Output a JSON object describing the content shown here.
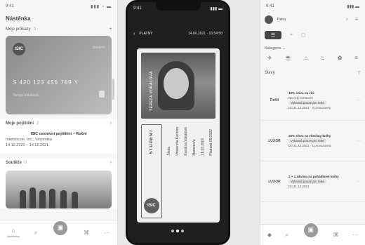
{
  "left": {
    "status_time": "9:41",
    "status_icons": "▮▮▮ ◔ ▬",
    "title": "Nástěnka",
    "cards_section": {
      "label": "Moje průkazy",
      "count": "0",
      "action": "+"
    },
    "card": {
      "logo": "ISIC",
      "tag": "Student",
      "number": "S 420 123 456 789 Y",
      "holder": "Tereza Vokálová"
    },
    "insurance_section": {
      "label": "Moje pojištění",
      "count": "2"
    },
    "insurance": {
      "title": "ISIC cestovní pojištění – Roční",
      "line1": "Intersoccer, Inc., Vincentka",
      "line2": "14.12.2020 – 14.12.2021"
    },
    "contests_section": {
      "label": "Soutěže",
      "count": "0"
    },
    "tabs": [
      {
        "icon": "⌂",
        "label": "Nástěnka"
      },
      {
        "icon": "⌕",
        "label": ""
      },
      {
        "icon": "▣",
        "label": ""
      },
      {
        "icon": "⌘",
        "label": ""
      },
      {
        "icon": "···",
        "label": ""
      }
    ]
  },
  "phone": {
    "status_time": "9:41",
    "status_icons": "▮▮▮ ▬",
    "back_icon": "‹",
    "valid_label": "PLATNÝ",
    "datetime": "14.06.2021 · 16:54:58",
    "name_vertical": "TEREZA VOKÁLOVÁ",
    "brand_top": "INTERNATIONAL STUDENT IDENTITY CARD",
    "brand_student": "STUDENT",
    "brand_circle": "ISIC",
    "details": [
      "Škola",
      "Univerzita Karlova",
      "Karolína Vokálová",
      "Narozen/a",
      "21.03.2001",
      "Platnost 09/2022"
    ]
  },
  "right": {
    "status_time": "9:41",
    "status_icons": "▮▮▮ ▬",
    "user_name": "Petra",
    "user_icons": "⌕ ✉",
    "view_icons": {
      "list": "☰",
      "map": "⌖",
      "box": "▢"
    },
    "categories_label": "Kategorie",
    "categories_chevron": "⌄",
    "category_icons": [
      "✈",
      "☕",
      "⌂",
      "♨",
      "✿",
      "≡"
    ],
    "deals_label": "Slevy",
    "filter_icon": "⊤",
    "deals": [
      {
        "logo": "Refill",
        "title": "10% sleva na vše",
        "line1": "Na celý sortiment",
        "pill": "Vybraná pouze pro tebe",
        "line2": "Do 31.12.2021 · 2 provozovny"
      },
      {
        "logo": "LUXOR",
        "title": "20% sleva na všechny knihy",
        "line1": "",
        "pill": "Vybraná pouze pro tebe",
        "line2": "Do 31.12.2021 · 1 provozovna"
      },
      {
        "logo": "LUXOR",
        "title": "2 + 1 zdarma na pohádkové knihy",
        "line1": "",
        "pill": "Vybraná pouze pro tebe",
        "line2": "Do 31.12.2021"
      }
    ],
    "deal_more": "···",
    "tabs": [
      "◆",
      "⌕",
      "▣",
      "⌘",
      "···"
    ]
  }
}
